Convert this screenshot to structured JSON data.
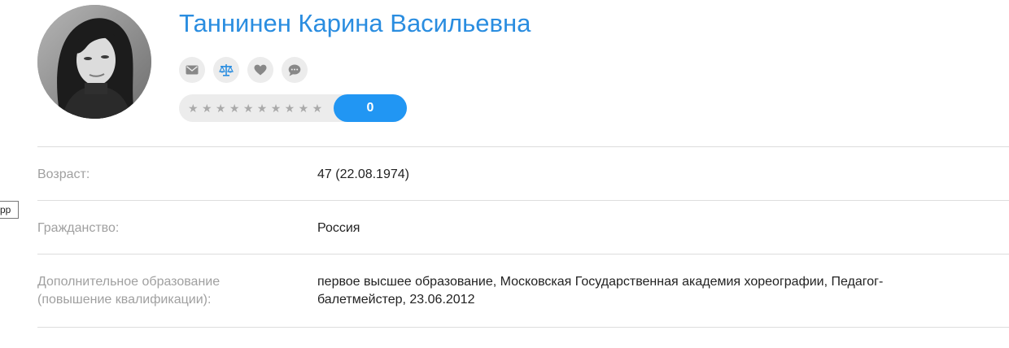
{
  "side_tab": {
    "label": "pp"
  },
  "profile": {
    "name": "Таннинен Карина Васильевна"
  },
  "actions": [
    {
      "name": "message-button",
      "icon": "envelope-icon",
      "color": "#888888"
    },
    {
      "name": "compare-button",
      "icon": "scales-icon",
      "color": "#2a8de0"
    },
    {
      "name": "favorite-button",
      "icon": "heart-icon",
      "color": "#888888"
    },
    {
      "name": "comment-button",
      "icon": "chat-bubble-icon",
      "color": "#888888"
    }
  ],
  "rating": {
    "stars_total": 10,
    "stars_filled": 0,
    "star_glyph": "★",
    "score": "0"
  },
  "info": {
    "age": {
      "label": "Возраст:",
      "value": "47 (22.08.1974)"
    },
    "citizenship": {
      "label": "Гражданство:",
      "value": "Россия"
    },
    "education": {
      "label": "Дополнительное образование (повышение квалификации):",
      "value": "первое высшее образование, Московская Государственная академия хореографии, Педагог-балетмейстер, 23.06.2012"
    }
  },
  "colors": {
    "accent": "#2196f3",
    "name": "#2a8de0",
    "label": "#a0a0a0",
    "divider": "#dddddd",
    "button_bg": "#ececec"
  }
}
